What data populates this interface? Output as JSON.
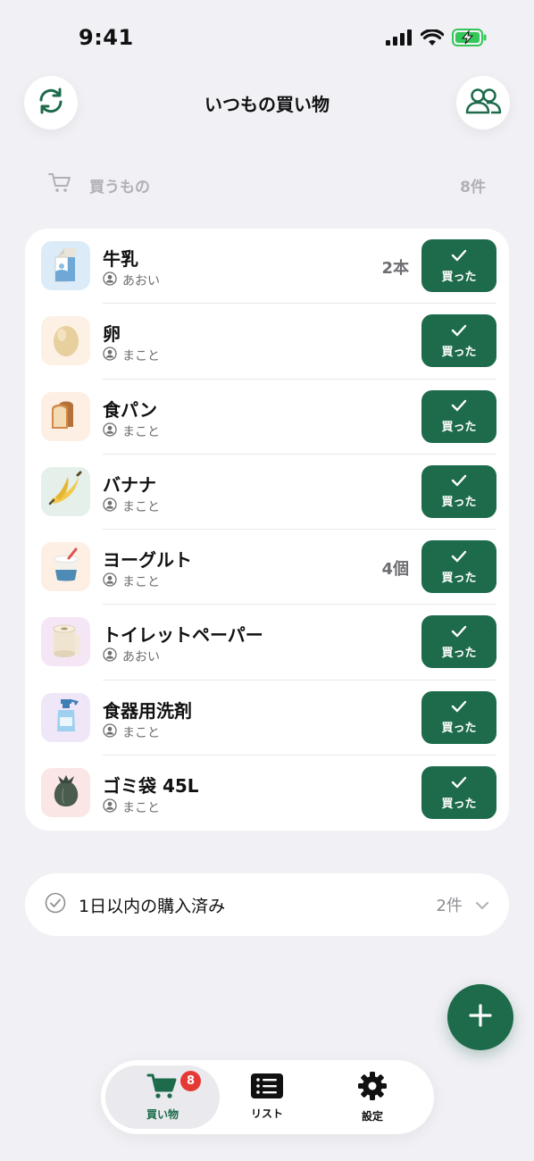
{
  "status_bar": {
    "time": "9:41"
  },
  "header": {
    "title": "いつもの買い物"
  },
  "section": {
    "label": "買うもの",
    "count": "8件"
  },
  "items": [
    {
      "name": "牛乳",
      "user": "あおい",
      "qty": "2本",
      "button": "買った",
      "icon": "milk-icon",
      "bg": "#dbecf8"
    },
    {
      "name": "卵",
      "user": "まこと",
      "qty": "",
      "button": "買った",
      "icon": "egg-icon",
      "bg": "#fdf0e4"
    },
    {
      "name": "食パン",
      "user": "まこと",
      "qty": "",
      "button": "買った",
      "icon": "bread-icon",
      "bg": "#fdefe4"
    },
    {
      "name": "バナナ",
      "user": "まこと",
      "qty": "",
      "button": "買った",
      "icon": "banana-icon",
      "bg": "#e5f0ea"
    },
    {
      "name": "ヨーグルト",
      "user": "まこと",
      "qty": "4個",
      "button": "買った",
      "icon": "yogurt-icon",
      "bg": "#fdefe4"
    },
    {
      "name": "トイレットペーパー",
      "user": "あおい",
      "qty": "",
      "button": "買った",
      "icon": "toilet-paper-icon",
      "bg": "#f5e6f6"
    },
    {
      "name": "食器用洗剤",
      "user": "まこと",
      "qty": "",
      "button": "買った",
      "icon": "dish-soap-icon",
      "bg": "#efe6f8"
    },
    {
      "name": "ゴミ袋 45L",
      "user": "まこと",
      "qty": "",
      "button": "買った",
      "icon": "trash-bag-icon",
      "bg": "#fbe6e6"
    }
  ],
  "purchased": {
    "label": "1日以内の購入済み",
    "count": "2件"
  },
  "tabs": [
    {
      "label": "買い物",
      "badge": "8",
      "icon": "cart-icon"
    },
    {
      "label": "リスト",
      "icon": "list-icon"
    },
    {
      "label": "設定",
      "icon": "gear-icon"
    }
  ],
  "colors": {
    "accent": "#1d6b4b",
    "badge": "#e53935",
    "background": "#f1f0f5"
  }
}
